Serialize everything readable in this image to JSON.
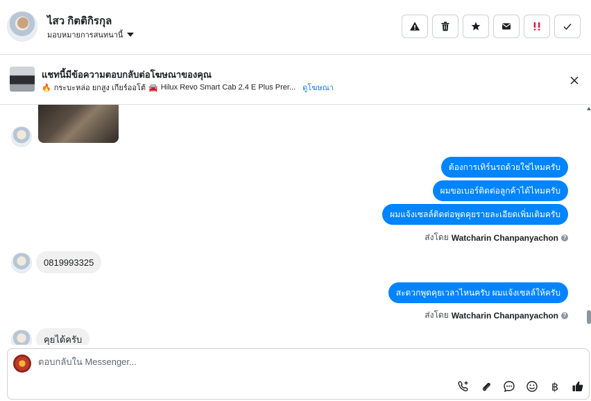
{
  "header": {
    "contact_name": "ไสว กิตติกิรกุล",
    "assign_label": "มอบหมายการสนทนานี้",
    "actions": [
      {
        "name": "report-spam-button",
        "icon": "warning-icon"
      },
      {
        "name": "delete-button",
        "icon": "trash-icon"
      },
      {
        "name": "star-button",
        "icon": "star-icon"
      },
      {
        "name": "mark-unread-button",
        "icon": "envelope-icon"
      },
      {
        "name": "follow-up-button",
        "icon": "exclamation-icon"
      },
      {
        "name": "mark-done-button",
        "icon": "check-icon"
      }
    ]
  },
  "ad_banner": {
    "title": "แชทนี้มีข้อความตอบกลับต่อโฆษณาของคุณ",
    "emoji_fire": "🔥",
    "promo_text": "กระบะหล่อ ยกสูง เกียร์ออโต้",
    "emoji_car": "🚘",
    "ad_name": "Hilux Revo Smart Cab 2.4 E Plus Prer...",
    "view_ad_link": "ดูโฆษณา"
  },
  "messages": {
    "outgoing_group_1": [
      "ต้องการเทิร์นรถด้วยใช่ไหมครับ",
      "ผมขอเบอร์ติดต่อลูกค้าได้ไหมครับ",
      "ผมแจ้งเซลล์ติดต่อพูดคุยรายละเอียดเพิ่มเติมครับ"
    ],
    "sent_by_prefix": "ส่งโดย",
    "sent_by_name": "Watcharin Chanpanyachon",
    "incoming_phone": "0819993325",
    "outgoing_group_2": [
      "สะดวกพูดคุยเวลาไหนครับ ผมแจ้งเซลล์ให้ครับ"
    ],
    "incoming_partial": "คุยได้ครับ"
  },
  "composer": {
    "placeholder": "ตอบกลับใน Messenger...",
    "baht_symbol": "฿"
  },
  "colors": {
    "outgoing_bubble": "#0084ff",
    "incoming_bubble": "#f0f0f0",
    "link": "#1877f2",
    "follow_up_red": "#e41e3f"
  }
}
